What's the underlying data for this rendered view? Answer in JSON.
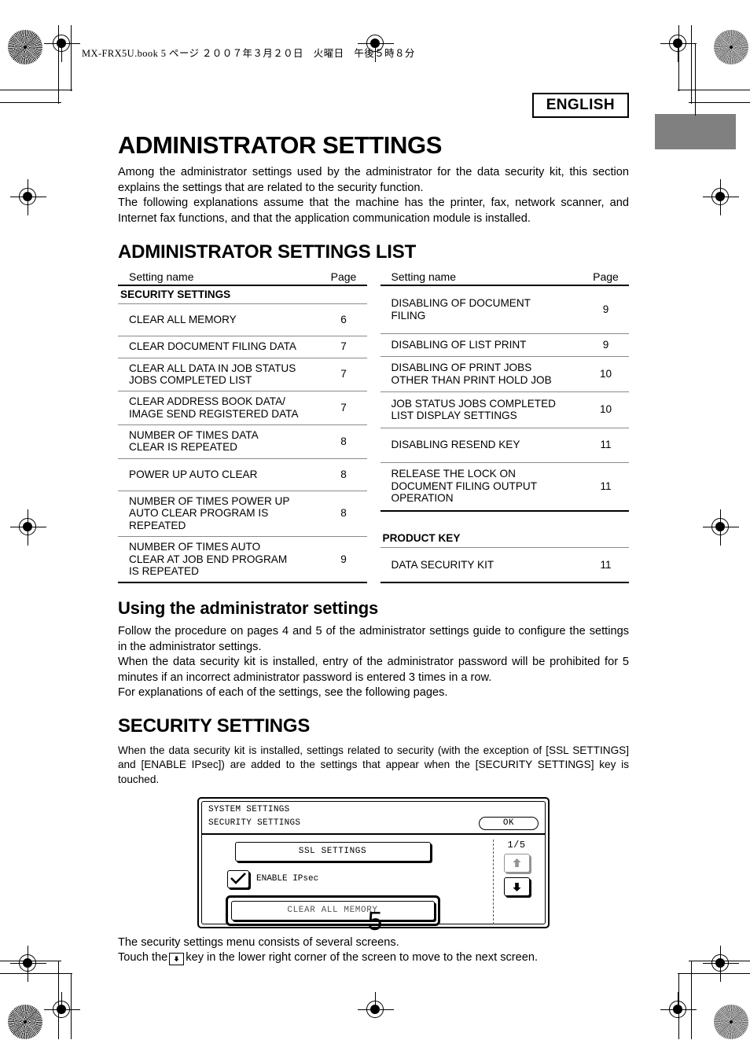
{
  "print_marks": {
    "file_header": "MX-FRX5U.book  5 ページ  ２００７年３月２０日　火曜日　午後５時８分"
  },
  "language_badge": "ENGLISH",
  "page_number": "5",
  "title": "ADMINISTRATOR SETTINGS",
  "intro": [
    "Among the administrator settings used by the administrator for the data security kit, this section explains the settings that are related to the security function.",
    "The following explanations assume that the machine has the printer, fax, network scanner, and Internet fax functions, and  that the application communication module is installed."
  ],
  "list_section": {
    "heading": "ADMINISTRATOR SETTINGS LIST",
    "columns": {
      "name": "Setting name",
      "page": "Page"
    },
    "left_table": [
      {
        "type": "group",
        "name": "SECURITY SETTINGS",
        "page": ""
      },
      {
        "type": "row",
        "name": "CLEAR ALL MEMORY",
        "page": "6",
        "tall": true
      },
      {
        "type": "row",
        "name": "CLEAR DOCUMENT FILING DATA",
        "page": "7"
      },
      {
        "type": "row",
        "name": "CLEAR ALL DATA IN JOB STATUS\nJOBS COMPLETED LIST",
        "page": "7"
      },
      {
        "type": "row",
        "name": "CLEAR ADDRESS BOOK DATA/\nIMAGE SEND REGISTERED DATA",
        "page": "7"
      },
      {
        "type": "row",
        "name": "NUMBER OF TIMES DATA\nCLEAR IS REPEATED",
        "page": "8"
      },
      {
        "type": "row",
        "name": "POWER UP AUTO CLEAR",
        "page": "8",
        "tall": true
      },
      {
        "type": "row",
        "name": "NUMBER OF TIMES POWER UP\nAUTO CLEAR PROGRAM IS\nREPEATED",
        "page": "8"
      },
      {
        "type": "row",
        "name": "NUMBER OF TIMES AUTO\nCLEAR AT JOB END PROGRAM\nIS REPEATED",
        "page": "9",
        "last": true
      }
    ],
    "right_table": [
      {
        "type": "row",
        "name": "DISABLING OF DOCUMENT\nFILING",
        "page": "9",
        "tall": true
      },
      {
        "type": "row",
        "name": "DISABLING OF LIST PRINT",
        "page": "9"
      },
      {
        "type": "row",
        "name": "DISABLING OF PRINT JOBS\nOTHER THAN PRINT HOLD JOB",
        "page": "10"
      },
      {
        "type": "row",
        "name": "JOB STATUS JOBS COMPLETED\nLIST DISPLAY SETTINGS",
        "page": "10"
      },
      {
        "type": "row",
        "name": "DISABLING RESEND KEY",
        "page": "11",
        "tall": true
      },
      {
        "type": "row",
        "name": "RELEASE THE LOCK ON\nDOCUMENT FILING OUTPUT\nOPERATION",
        "page": "11",
        "last": true
      },
      {
        "type": "spacer"
      },
      {
        "type": "group",
        "name": "PRODUCT KEY",
        "page": ""
      },
      {
        "type": "row",
        "name": "DATA SECURITY KIT",
        "page": "11",
        "tall": true,
        "last": true
      }
    ]
  },
  "using_section": {
    "heading": "Using the administrator settings",
    "paragraphs": [
      "Follow the procedure on pages 4 and 5 of the administrator settings guide to configure the settings in the administrator settings.",
      "When the data security kit is installed, entry of the administrator password will be prohibited for 5 minutes if an incorrect administrator password is entered 3 times in a row.",
      "For explanations of each of the settings, see the following pages."
    ]
  },
  "security_section": {
    "heading": "SECURITY SETTINGS",
    "paragraph": "When the data security kit is installed, settings related to security (with the exception of [SSL SETTINGS] and [ENABLE IPsec]) are added to the settings that appear when the [SECURITY SETTINGS] key is touched."
  },
  "lcd": {
    "system_title": "SYSTEM SETTINGS",
    "screen_title": "SECURITY SETTINGS",
    "ok_label": "OK",
    "ssl_button": "SSL SETTINGS",
    "ipsec_label": "ENABLE IPsec",
    "ipsec_checked": true,
    "clear_memory_button": "CLEAR ALL MEMORY",
    "page_indicator": "1/5",
    "scroll_up_enabled": false,
    "scroll_down_enabled": true
  },
  "footer_notes": {
    "line1": "The security settings menu consists of several screens.",
    "line2_before": "Touch the",
    "line2_after": "key in the lower right corner of the screen to move to the next screen."
  }
}
